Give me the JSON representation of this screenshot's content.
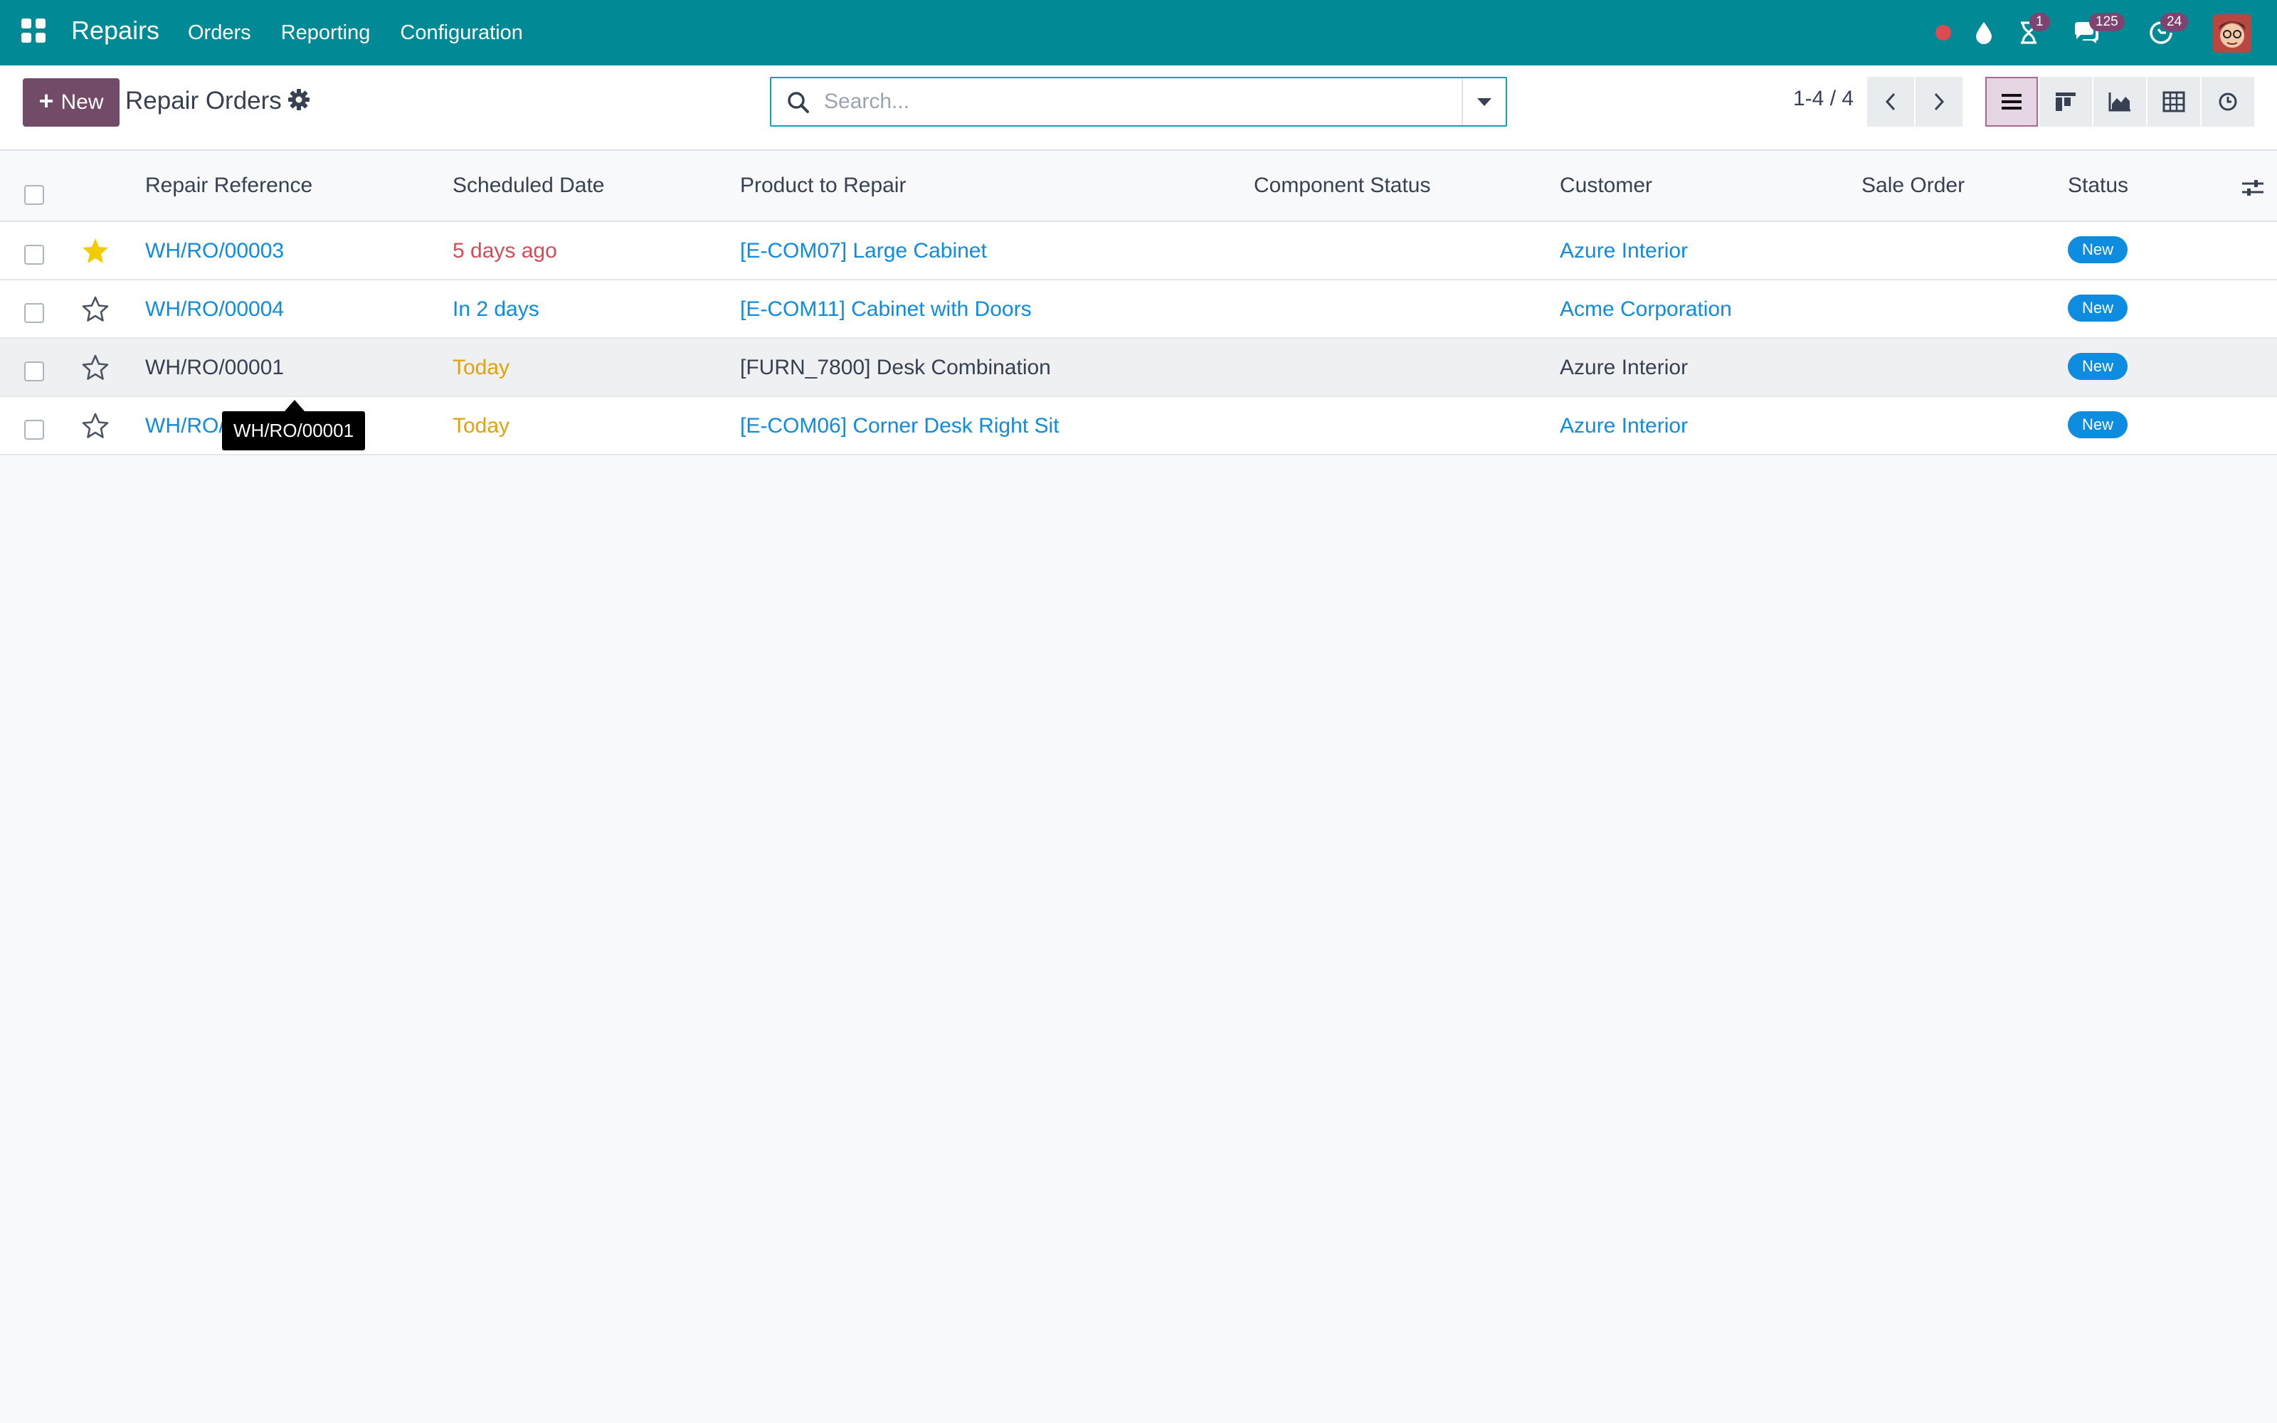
{
  "navbar": {
    "brand": "Repairs",
    "menu": [
      "Orders",
      "Reporting",
      "Configuration"
    ],
    "activity_count": "1",
    "messages_count": "125",
    "updates_count": "24",
    "accent": "#018a96"
  },
  "control_panel": {
    "new_label": "New",
    "title": "Repair Orders",
    "search_placeholder": "Search...",
    "pager": "1-4 / 4",
    "views": [
      "list-view-icon",
      "kanban-view-icon",
      "graph-view-icon",
      "pivot-view-icon",
      "activity-view-icon"
    ],
    "active_view": "list-view-icon"
  },
  "table": {
    "columns": [
      "Repair Reference",
      "Scheduled Date",
      "Product to Repair",
      "Component Status",
      "Customer",
      "Sale Order",
      "Status"
    ],
    "rows": [
      {
        "starred": true,
        "reference": "WH/RO/00003",
        "date": "5 days ago",
        "date_state": "danger",
        "product": "[E-COM07] Large Cabinet",
        "component_status": "",
        "customer": "Azure Interior",
        "sale_order": "",
        "status": "New"
      },
      {
        "starred": false,
        "reference": "WH/RO/00004",
        "date": "In 2 days",
        "date_state": "info",
        "product": "[E-COM11] Cabinet with Doors",
        "component_status": "",
        "customer": "Acme Corporation",
        "sale_order": "",
        "status": "New"
      },
      {
        "starred": false,
        "reference": "WH/RO/00001",
        "date": "Today",
        "date_state": "warning",
        "product": "[FURN_7800] Desk Combination",
        "component_status": "",
        "customer": "Azure Interior",
        "sale_order": "",
        "status": "New"
      },
      {
        "starred": false,
        "reference": "WH/RO/00002",
        "date": "Today",
        "date_state": "warning",
        "product": "[E-COM06] Corner Desk Right Sit",
        "component_status": "",
        "customer": "Azure Interior",
        "sale_order": "",
        "status": "New"
      }
    ]
  },
  "tooltip": "WH/RO/00001"
}
